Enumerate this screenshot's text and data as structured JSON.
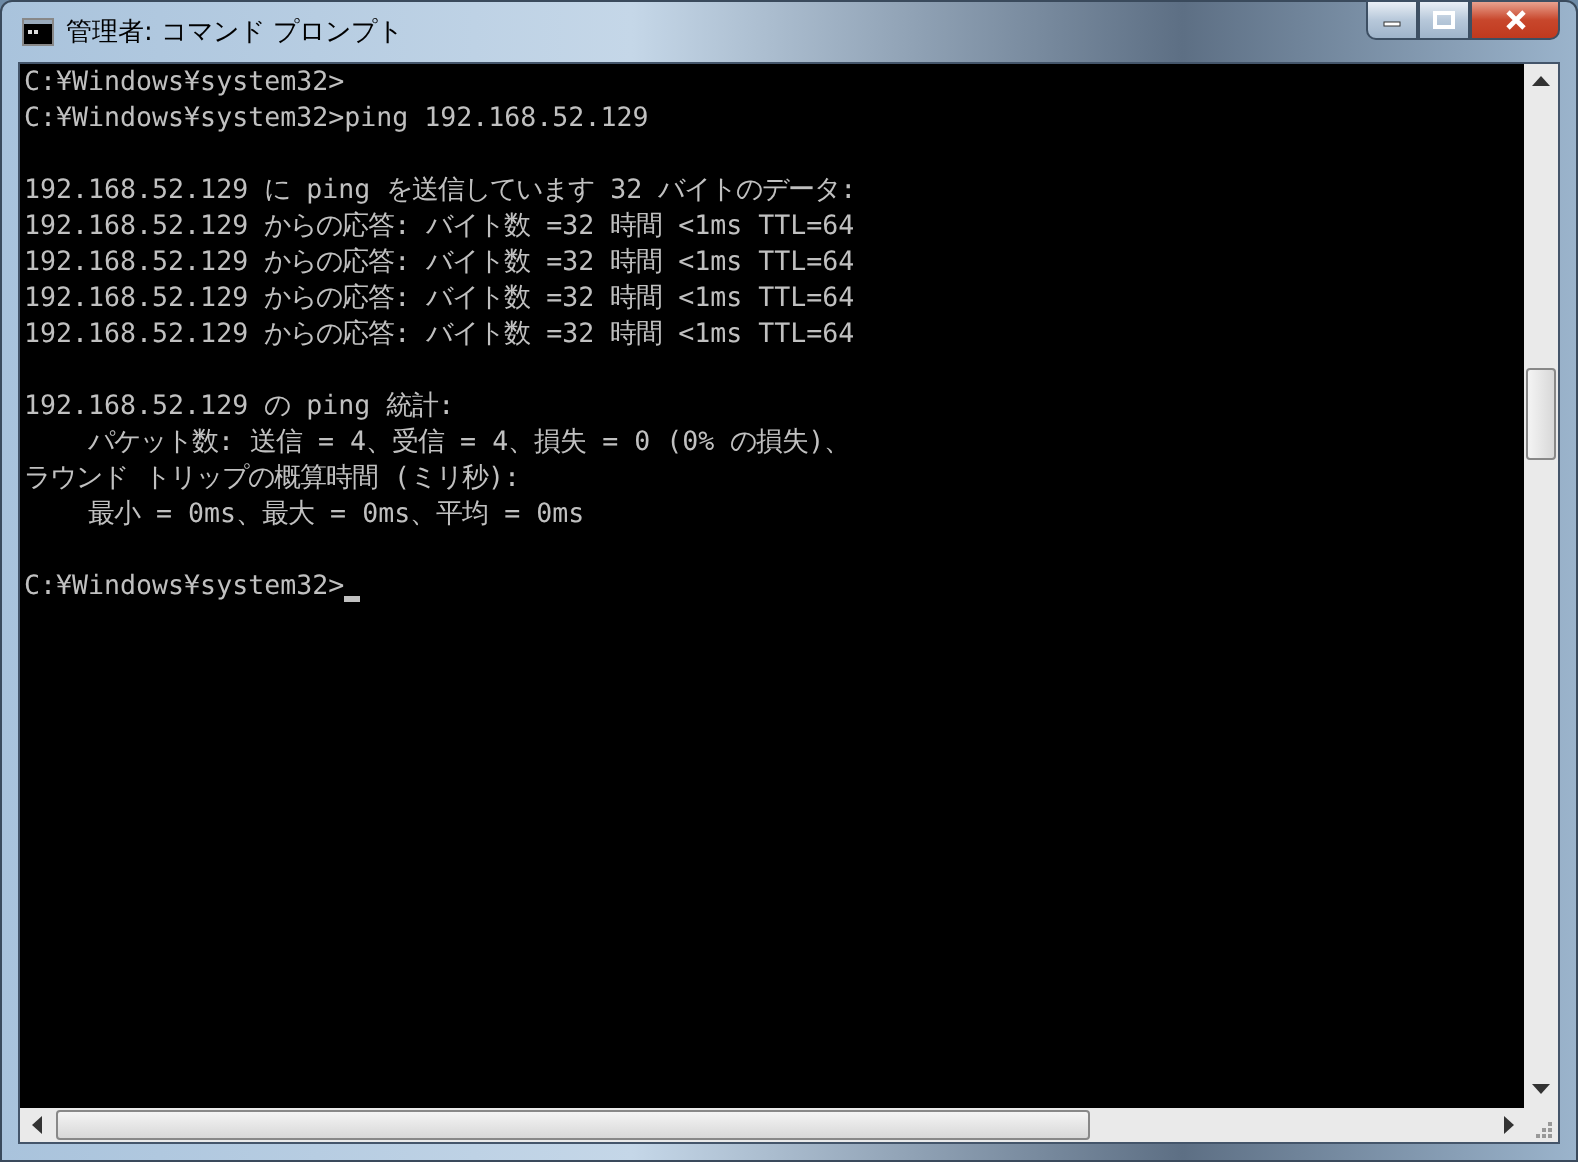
{
  "window": {
    "title": "管理者: コマンド プロンプト"
  },
  "console": {
    "blocks": [
      [
        "C:¥Windows¥system32>",
        "C:¥Windows¥system32>ping 192.168.52.129"
      ],
      [
        "192.168.52.129 に ping を送信しています 32 バイトのデータ:",
        "192.168.52.129 からの応答: バイト数 =32 時間 <1ms TTL=64",
        "192.168.52.129 からの応答: バイト数 =32 時間 <1ms TTL=64",
        "192.168.52.129 からの応答: バイト数 =32 時間 <1ms TTL=64",
        "192.168.52.129 からの応答: バイト数 =32 時間 <1ms TTL=64"
      ],
      [
        "192.168.52.129 の ping 統計:",
        "    パケット数: 送信 = 4、受信 = 4、損失 = 0 (0% の損失)、",
        "ラウンド トリップの概算時間 (ミリ秒):",
        "    最小 = 0ms、最大 = 0ms、平均 = 0ms"
      ],
      [
        "C:¥Windows¥system32>"
      ]
    ],
    "cursor": true
  }
}
